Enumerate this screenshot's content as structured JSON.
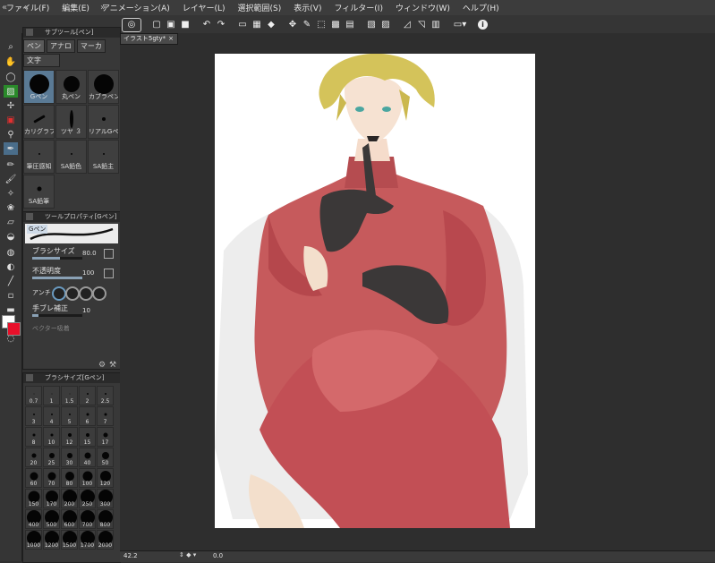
{
  "menu": [
    {
      "label": "ファイル(F)"
    },
    {
      "label": "編集(E)"
    },
    {
      "label": "アニメーション(A)"
    },
    {
      "label": "レイヤー(L)"
    },
    {
      "label": "選択範囲(S)"
    },
    {
      "label": "表示(V)"
    },
    {
      "label": "フィルター(I)"
    },
    {
      "label": "ウィンドウ(W)"
    },
    {
      "label": "ヘルプ(H)"
    }
  ],
  "document": {
    "tab_title": "イラスト5gty*"
  },
  "subtool": {
    "title": "サブツール[ペン]",
    "tabs": [
      {
        "label": "ペン"
      },
      {
        "label": "アナロ"
      },
      {
        "label": "マーカ"
      }
    ],
    "text_tab": "文字",
    "brushes": [
      {
        "label": "Gペン",
        "size": 22
      },
      {
        "label": "丸ペン",
        "size": 18
      },
      {
        "label": "カブラペン",
        "size": 22
      },
      {
        "label": "カリグラフィ",
        "size": 0
      },
      {
        "label": "ツヤ ３",
        "size": 0
      },
      {
        "label": "リアルGペン",
        "size": 4
      },
      {
        "label": "筆圧感知",
        "size": 2
      },
      {
        "label": "SA鉛色",
        "size": 2
      },
      {
        "label": "SA鉛主",
        "size": 2
      },
      {
        "label": "SA鉛筆",
        "size": 5
      }
    ]
  },
  "tool_property": {
    "title": "ツールプロパティ[Gペン]",
    "preset_label": "Gペン",
    "brush_size": {
      "label": "ブラシサイズ",
      "value": "80.0",
      "fill": 0.55
    },
    "opacity": {
      "label": "不透明度",
      "value": "100",
      "fill": 1.0
    },
    "antialias_label": "アンチ",
    "stabilization": {
      "label": "手ブレ補正",
      "value": "10",
      "fill": 0.12
    },
    "vector_label": "ベクター吸着"
  },
  "brush_size_panel": {
    "title": "ブラシサイズ[Gペン]",
    "sizes": [
      "0.7",
      "1",
      "1.5",
      "2",
      "2.5",
      "3",
      "4",
      "5",
      "6",
      "7",
      "8",
      "10",
      "12",
      "15",
      "17",
      "20",
      "25",
      "30",
      "40",
      "50",
      "60",
      "70",
      "80",
      "100",
      "120",
      "150",
      "170",
      "200",
      "250",
      "300",
      "400",
      "500",
      "600",
      "700",
      "800",
      "1000",
      "1200",
      "1500",
      "1700",
      "2000"
    ]
  },
  "status": {
    "zoom": "42.2",
    "angle": "0.0"
  },
  "colors": {
    "main": "#ffffff",
    "sub": "#e8102a",
    "accent": "#4a6d8a"
  }
}
